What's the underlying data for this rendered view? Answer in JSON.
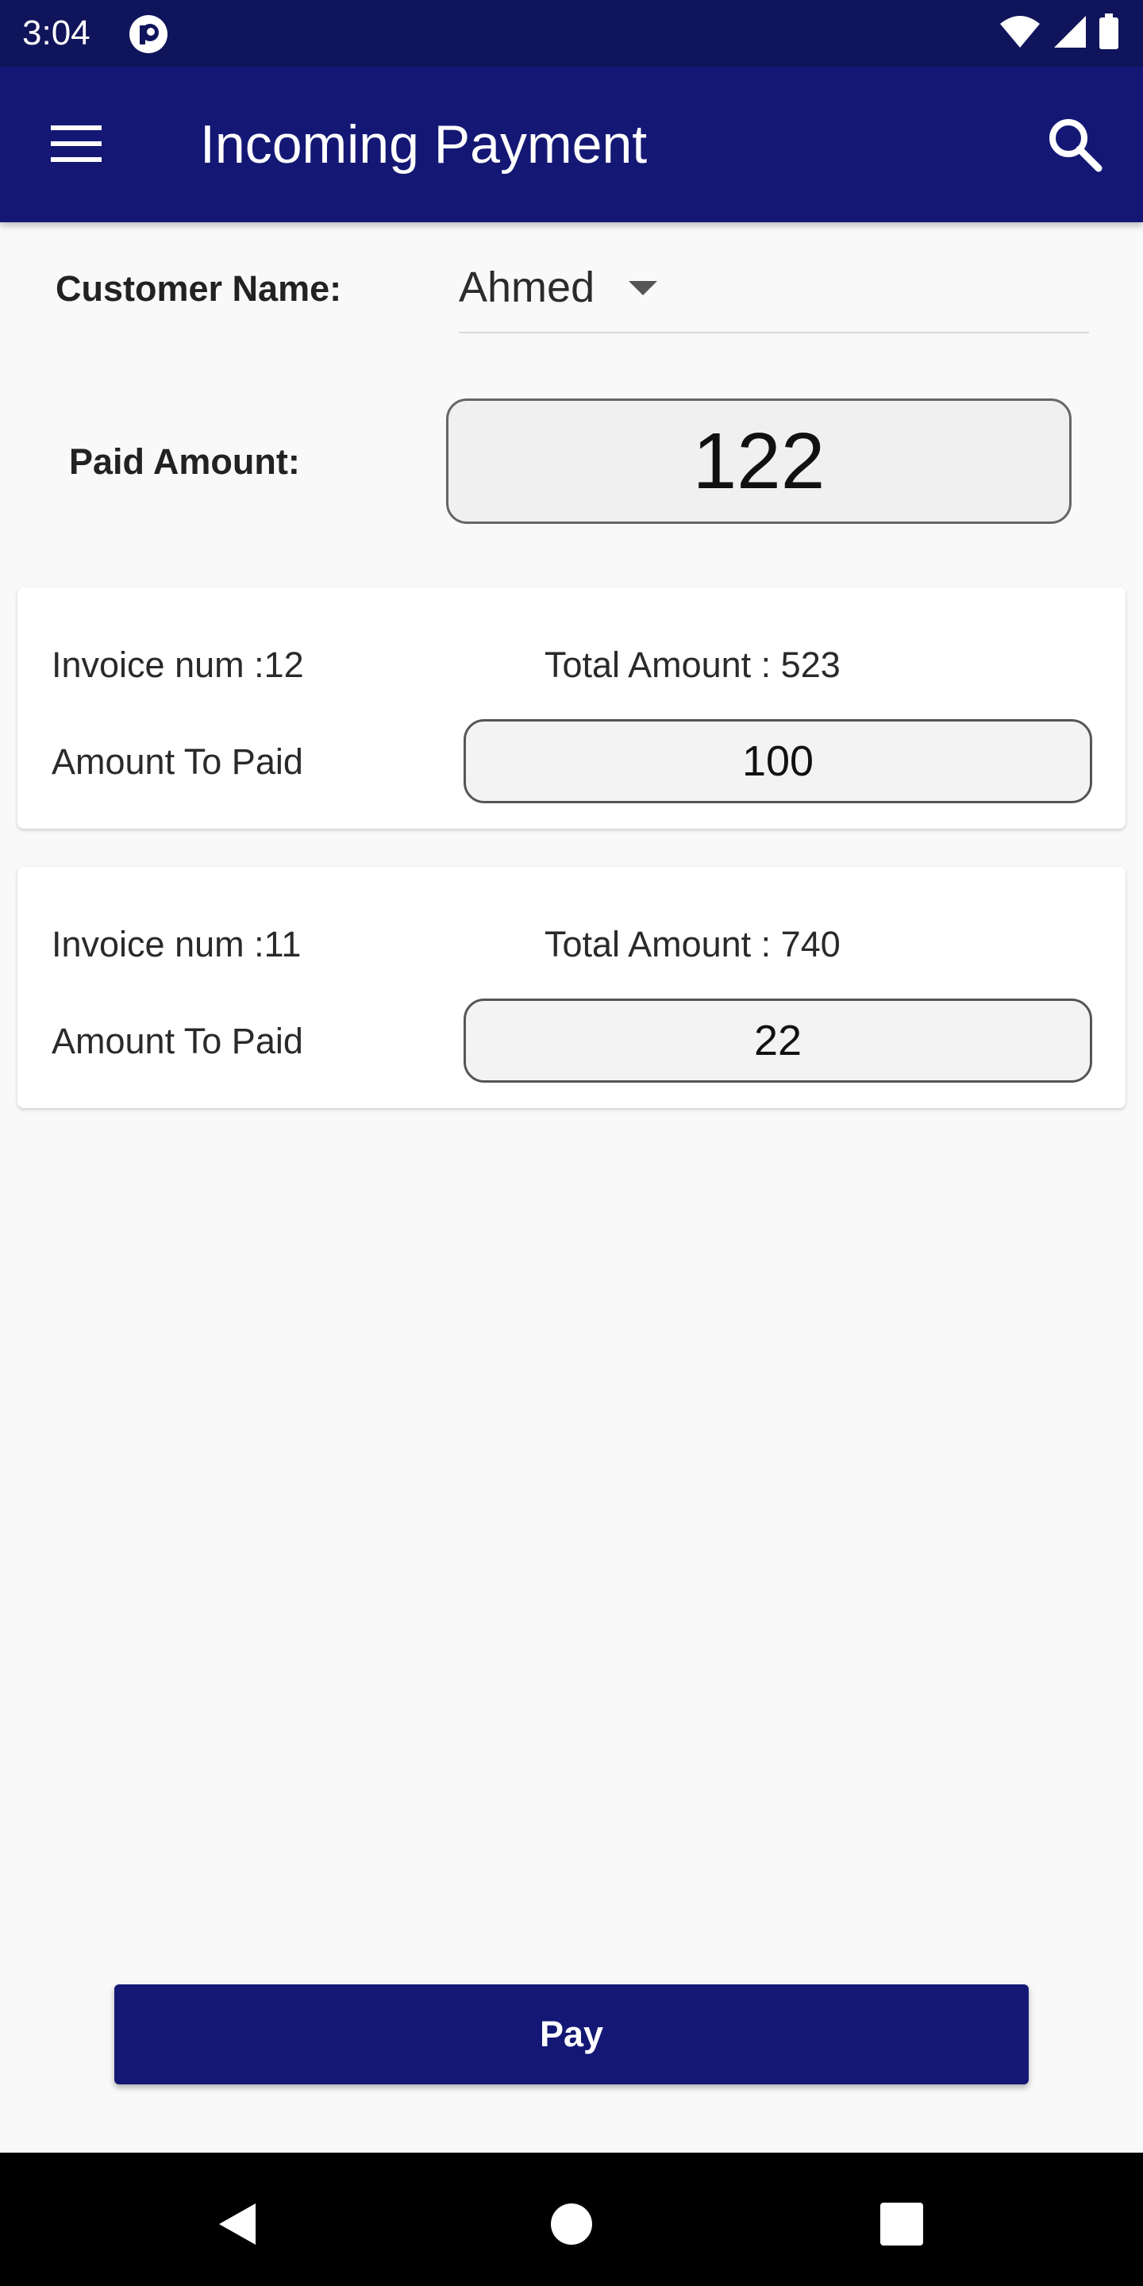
{
  "status_bar": {
    "time": "3:04",
    "app_icon": "pocket-casts-icon",
    "icons": [
      "wifi-icon",
      "cellular-signal-icon",
      "battery-icon"
    ]
  },
  "app_bar": {
    "title": "Incoming Payment",
    "menu_icon": "hamburger-menu-icon",
    "search_icon": "search-icon",
    "color": "#141874"
  },
  "form": {
    "customer_label": "Customer Name:",
    "customer_value": "Ahmed",
    "paid_label": "Paid Amount:",
    "paid_value": "122"
  },
  "invoices": [
    {
      "invoice_label": "Invoice num :12",
      "total_label": "Total Amount : 523",
      "amount_label": "Amount To Paid",
      "amount_value": "100"
    },
    {
      "invoice_label": "Invoice num :11",
      "total_label": "Total Amount : 740",
      "amount_label": "Amount To Paid",
      "amount_value": "22"
    }
  ],
  "pay_button": {
    "label": "Pay"
  },
  "nav_bar": {
    "icons": [
      "back-icon",
      "home-icon",
      "recents-icon"
    ]
  }
}
